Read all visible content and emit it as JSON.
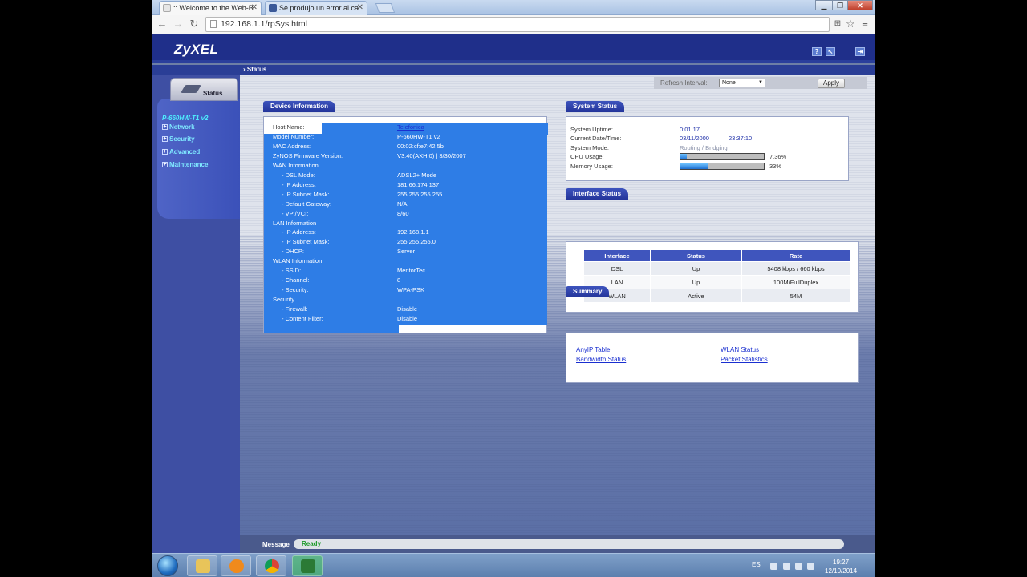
{
  "browser": {
    "tabs": [
      {
        "label": ":: Welcome to the Web-B",
        "active": true
      },
      {
        "label": "Se produjo un error al ca",
        "active": false
      }
    ],
    "url": "192.168.1.1/rpSys.html"
  },
  "header": {
    "logo": "ZyXEL",
    "page_title": "Status"
  },
  "nav": {
    "status_tab": "Status",
    "device_model": "P-660HW-T1 v2",
    "items": [
      "Network",
      "Security",
      "Advanced",
      "Maintenance"
    ]
  },
  "refresh": {
    "label": "Refresh Interval:",
    "value": "None",
    "apply": "Apply"
  },
  "device_info": {
    "title": "Device Information",
    "rows": [
      {
        "label": "Host Name:",
        "value": "Telefonica",
        "link": true
      },
      {
        "label": "Model Number:",
        "value": "P-660HW-T1 v2"
      },
      {
        "label": "MAC Address:",
        "value": "00:02:cf:e7:42:5b"
      },
      {
        "label": "ZyNOS Firmware Version:",
        "value": "V3.40(AXH.0) | 3/30/2007"
      },
      {
        "label": "WAN Information",
        "value": ""
      },
      {
        "label": "- DSL Mode:",
        "value": "ADSL2+ Mode"
      },
      {
        "label": "- IP Address:",
        "value": "181.66.174.137"
      },
      {
        "label": "- IP Subnet Mask:",
        "value": "255.255.255.255"
      },
      {
        "label": "- Default Gateway:",
        "value": "N/A"
      },
      {
        "label": "- VPI/VCI:",
        "value": "8/60"
      },
      {
        "label": "LAN Information",
        "value": ""
      },
      {
        "label": "- IP Address:",
        "value": "192.168.1.1"
      },
      {
        "label": "- IP Subnet Mask:",
        "value": "255.255.255.0"
      },
      {
        "label": "- DHCP:",
        "value": "Server"
      },
      {
        "label": "WLAN Information",
        "value": ""
      },
      {
        "label": "- SSID:",
        "value": "MentorTec"
      },
      {
        "label": "- Channel:",
        "value": "8"
      },
      {
        "label": "- Security:",
        "value": "WPA-PSK"
      },
      {
        "label": "Security",
        "value": ""
      },
      {
        "label": "- Firewall:",
        "value": "Disable"
      },
      {
        "label": "- Content Filter:",
        "value": "Disable"
      }
    ]
  },
  "system_status": {
    "title": "System Status",
    "uptime_label": "System Uptime:",
    "uptime": "0:01:17",
    "datetime_label": "Current Date/Time:",
    "date": "03/11/2000",
    "time": "23:37:10",
    "mode_label": "System Mode:",
    "mode": "Routing / Bridging",
    "cpu_label": "CPU Usage:",
    "cpu_pct_text": "7.36%",
    "cpu_fraction": 0.0736,
    "mem_label": "Memory Usage:",
    "mem_pct_text": "33%",
    "mem_fraction": 0.33
  },
  "interface_status": {
    "title": "Interface Status",
    "headers": [
      "Interface",
      "Status",
      "Rate"
    ],
    "rows": [
      [
        "DSL",
        "Up",
        "5408 kbps / 660 kbps"
      ],
      [
        "LAN",
        "Up",
        "100M/FullDuplex"
      ],
      [
        "WLAN",
        "Active",
        "54M"
      ]
    ]
  },
  "summary": {
    "title": "Summary",
    "links": [
      "AnyIP Table",
      "WLAN Status",
      "Bandwidth Status",
      "Packet Statistics"
    ]
  },
  "message": {
    "label": "Message",
    "value": "Ready"
  },
  "taskbar": {
    "lang": "ES",
    "time": "19:27",
    "date": "12/10/2014"
  },
  "colors": {
    "selection": "#2e7de6",
    "header_blue": "#1f2f8a",
    "nav_cyan": "#7fe8ff",
    "ready_green": "#1d9b2a"
  }
}
